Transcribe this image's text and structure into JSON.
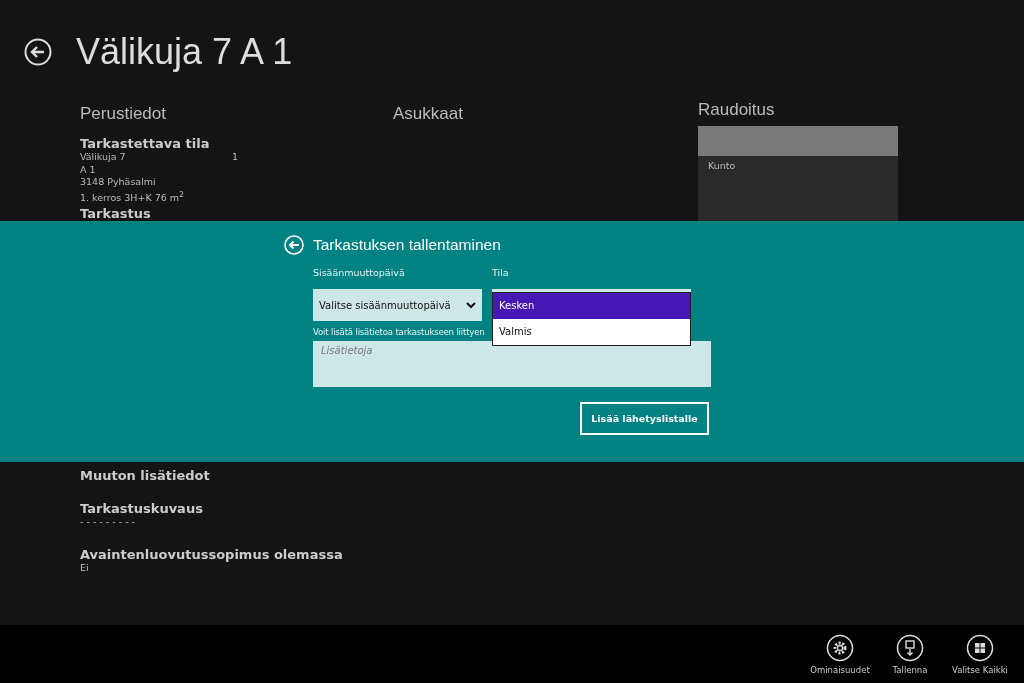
{
  "page": {
    "title": "Välikuja 7 A 1"
  },
  "basic_info": {
    "heading": "Perustiedot",
    "section_title": "Tarkastettava tila",
    "street": "Välikuja 7",
    "number": "1",
    "apartment": "A 1",
    "postal": "3148  Pyhäsalmi",
    "details": "1. kerros   3H+K   76 m$^{2}$",
    "next_section": "Tarkastus"
  },
  "residents": {
    "heading": "Asukkaat"
  },
  "reinforcement": {
    "heading": "Raudoitus",
    "row_label": "Kunto"
  },
  "lower_info": [
    {
      "title": "Muuton lisätiedot"
    },
    {
      "title": "Tarkastuskuvaus",
      "value": "- - - - - - - - -"
    },
    {
      "title": "Avaintenluovutussopimus olemassa",
      "value": "Ei"
    }
  ],
  "dialog": {
    "title": "Tarkastuksen tallentaminen",
    "date_label": "Sisäänmuuttopäivä",
    "date_value": "Valitse sisäänmuuttopäivä",
    "status_label": "Tila",
    "status_options": [
      {
        "label": "Kesken",
        "selected": true
      },
      {
        "label": "Valmis",
        "selected": false
      }
    ],
    "notes_label": "Voit lisätä lisätietoa tarkastukseen liittyen",
    "notes_placeholder": "Lisätietoja",
    "submit": "Lisää lähetyslistalle"
  },
  "app_bar": [
    {
      "kind": "settings",
      "label": "Ominaisuudet"
    },
    {
      "kind": "save",
      "label": "Tallenna"
    },
    {
      "kind": "select_all",
      "label": "Valitse Kaikki"
    }
  ]
}
